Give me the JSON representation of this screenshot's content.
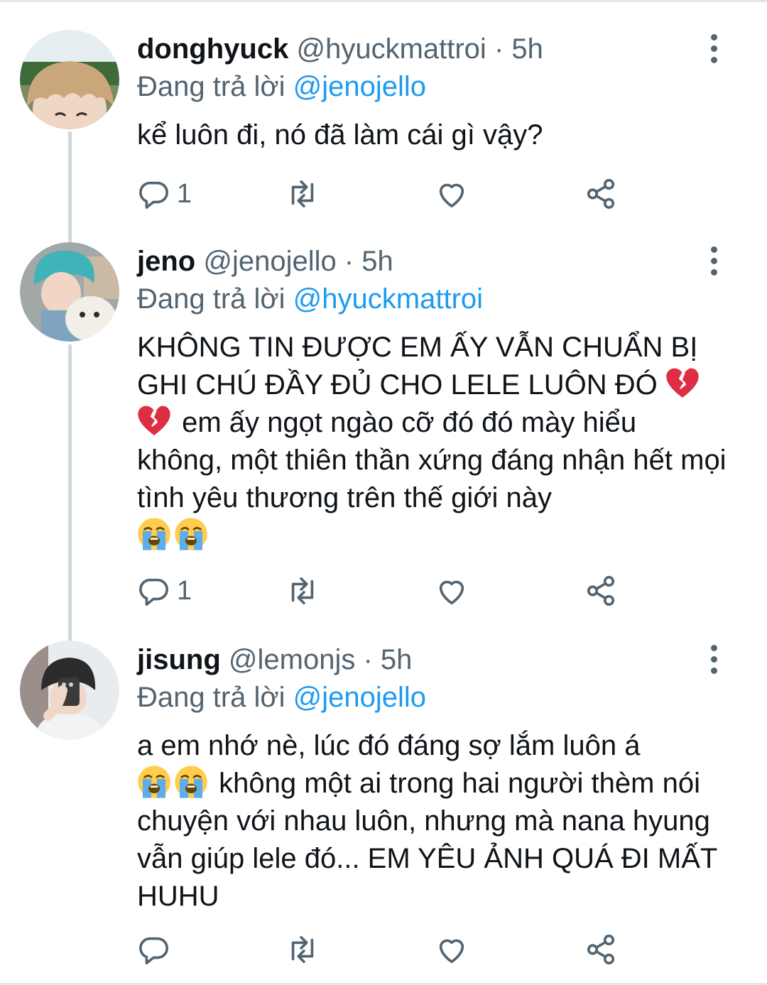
{
  "reply_prefix": "Đang trả lời",
  "colors": {
    "text": "#0f1419",
    "muted": "#536471",
    "link": "#1d9bf0",
    "thread_line": "#cfd9de"
  },
  "icons": {
    "reply": "reply-icon",
    "retweet": "retweet-icon",
    "like": "heart-icon",
    "share": "share-icon",
    "more": "more-vertical-icon",
    "emoji_broken_heart": "broken-heart-emoji",
    "emoji_crying": "loudly-crying-face-emoji"
  },
  "tweets": [
    {
      "name": "donghyuck",
      "handle": "@hyuckmattroi",
      "time": "· 5h",
      "replying_to": "@jenojello",
      "text": "kể luôn đi, nó đã làm cái gì vậy?",
      "reply_count": "1"
    },
    {
      "name": "jeno",
      "handle": "@jenojello",
      "time": "· 5h",
      "replying_to": "@hyuckmattroi",
      "text_1": "KHÔNG TIN ĐƯỢC EM ẤY VẪN CHUẨN BỊ GHI CHÚ ĐẦY ĐỦ CHO LELE LUÔN ĐÓ",
      "text_2": "em ấy ngọt ngào cỡ đó đó mày hiểu không, một thiên thần xứng đáng nhận hết mọi tình yêu thương trên thế giới này",
      "reply_count": "1"
    },
    {
      "name": "jisung",
      "handle": "@lemonjs",
      "time": "· 5h",
      "replying_to": "@jenojello",
      "text_1": "a em nhớ nè, lúc đó đáng sợ lắm luôn á",
      "text_2": "không một ai trong hai người thèm nói chuyện với nhau luôn, nhưng mà nana hyung vẫn giúp lele đó... EM YÊU ẢNH QUÁ ĐI MẤT HUHU",
      "reply_count": ""
    }
  ]
}
